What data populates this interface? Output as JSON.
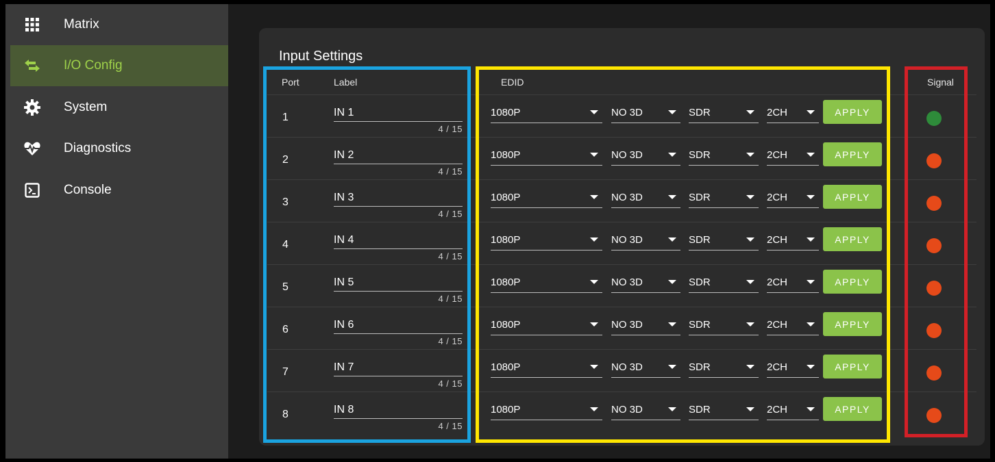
{
  "sidebar": {
    "items": [
      {
        "label": "Matrix",
        "icon": "grid-icon"
      },
      {
        "label": "I/O Config",
        "icon": "swap-arrows-icon"
      },
      {
        "label": "System",
        "icon": "gear-icon"
      },
      {
        "label": "Diagnostics",
        "icon": "heartbeat-icon"
      },
      {
        "label": "Console",
        "icon": "terminal-icon"
      }
    ]
  },
  "main": {
    "title": "Input Settings",
    "headers": {
      "port": "Port",
      "label": "Label",
      "edid": "EDID",
      "signal": "Signal"
    },
    "apply_label": "APPLY",
    "rows": [
      {
        "port": "1",
        "label": "IN 1",
        "counter": "4 / 15",
        "resolution": "1080P",
        "mode3d": "NO 3D",
        "hdr": "SDR",
        "audio": "2CH",
        "signal": "on"
      },
      {
        "port": "2",
        "label": "IN 2",
        "counter": "4 / 15",
        "resolution": "1080P",
        "mode3d": "NO 3D",
        "hdr": "SDR",
        "audio": "2CH",
        "signal": "off"
      },
      {
        "port": "3",
        "label": "IN 3",
        "counter": "4 / 15",
        "resolution": "1080P",
        "mode3d": "NO 3D",
        "hdr": "SDR",
        "audio": "2CH",
        "signal": "off"
      },
      {
        "port": "4",
        "label": "IN 4",
        "counter": "4 / 15",
        "resolution": "1080P",
        "mode3d": "NO 3D",
        "hdr": "SDR",
        "audio": "2CH",
        "signal": "off"
      },
      {
        "port": "5",
        "label": "IN 5",
        "counter": "4 / 15",
        "resolution": "1080P",
        "mode3d": "NO 3D",
        "hdr": "SDR",
        "audio": "2CH",
        "signal": "off"
      },
      {
        "port": "6",
        "label": "IN 6",
        "counter": "4 / 15",
        "resolution": "1080P",
        "mode3d": "NO 3D",
        "hdr": "SDR",
        "audio": "2CH",
        "signal": "off"
      },
      {
        "port": "7",
        "label": "IN 7",
        "counter": "4 / 15",
        "resolution": "1080P",
        "mode3d": "NO 3D",
        "hdr": "SDR",
        "audio": "2CH",
        "signal": "off"
      },
      {
        "port": "8",
        "label": "IN 8",
        "counter": "4 / 15",
        "resolution": "1080P",
        "mode3d": "NO 3D",
        "hdr": "SDR",
        "audio": "2CH",
        "signal": "off"
      }
    ]
  },
  "colors": {
    "accent": "#8bc34a",
    "signal_on": "#2e8b3a",
    "signal_off": "#e64a19",
    "annotation_label": "#1aa3e0",
    "annotation_edid": "#ffe600",
    "annotation_signal": "#d32027"
  }
}
